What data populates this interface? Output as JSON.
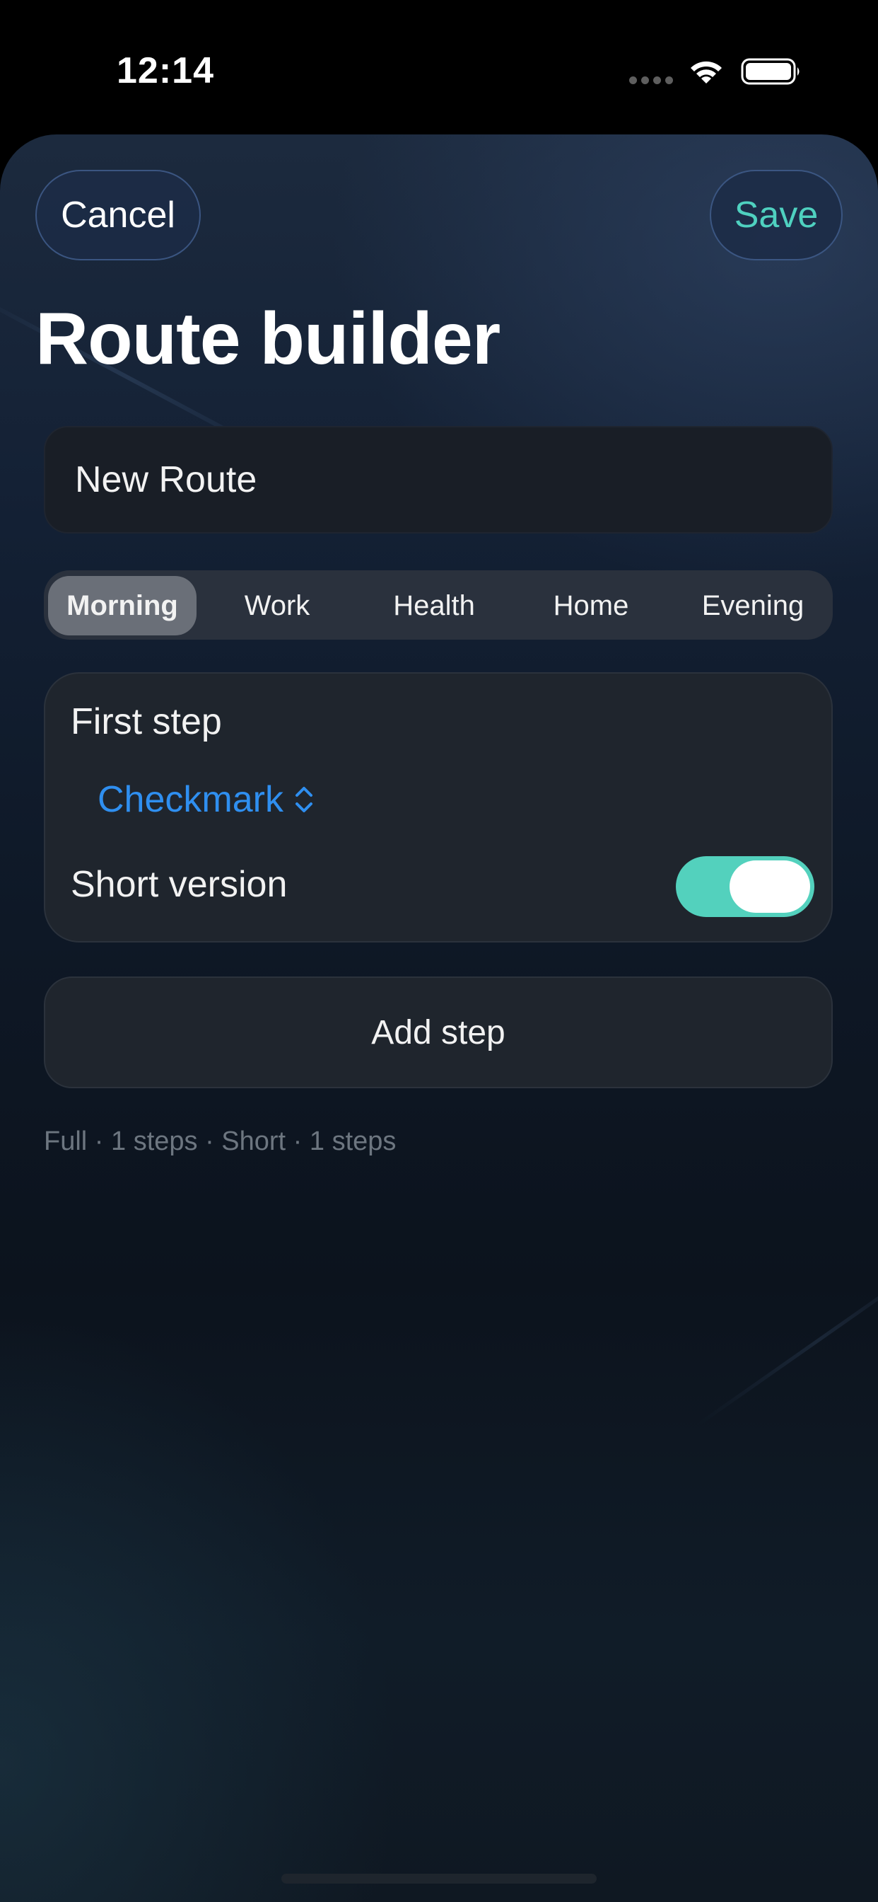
{
  "status_bar": {
    "time": "12:14",
    "icons": [
      "signal-dots-icon",
      "wifi-icon",
      "battery-icon"
    ]
  },
  "header": {
    "cancel_label": "Cancel",
    "save_label": "Save",
    "title": "Route builder"
  },
  "route_name": {
    "value": "New Route"
  },
  "segments": {
    "items": [
      "Morning",
      "Work",
      "Health",
      "Home",
      "Evening"
    ],
    "selected": "Morning"
  },
  "step_card": {
    "title": "First step",
    "picker_value": "Checkmark",
    "toggle_label": "Short version",
    "toggle_on": true
  },
  "add_step_label": "Add step",
  "summary": "Full · 1 steps · Short · 1 steps",
  "colors": {
    "accent_teal": "#4fd1c0",
    "toggle_on": "#53d1bd",
    "link_blue": "#2f8ff0",
    "background": "#0e1826"
  }
}
